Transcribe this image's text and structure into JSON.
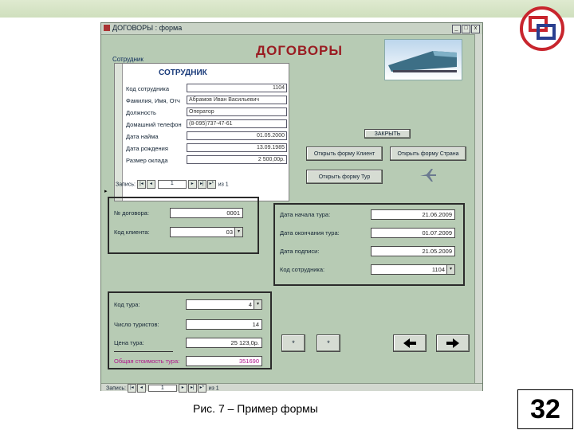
{
  "window": {
    "title": "ДОГОВОРЫ : форма",
    "min": "_",
    "max": "□",
    "close": "x"
  },
  "form": {
    "heading": "ДОГОВОРЫ",
    "subform_caption": "Сотрудник",
    "employee": {
      "title": "СОТРУДНИК",
      "fields": [
        {
          "label": "Код сотрудника",
          "value": "1104"
        },
        {
          "label": "Фамилия, Имя, Отч",
          "value": "Абрамов Иван Васильевич"
        },
        {
          "label": "Должность",
          "value": "Оператор"
        },
        {
          "label": "Домашний телефон",
          "value": "(8-095)737-47-61"
        },
        {
          "label": "Дата найма",
          "value": "01.05.2000"
        },
        {
          "label": "Дата рождения",
          "value": "13.09.1985"
        },
        {
          "label": "Размер оклада",
          "value": "2 500,00р."
        }
      ],
      "nav": {
        "label": "Запись:",
        "record": "1",
        "of": "из 1"
      }
    },
    "buttons": {
      "zakryt": "ЗАКРЫТЬ",
      "open_clients": "Открыть форму Клиент",
      "open_countries": "Открыть форму Страна",
      "open_tours": "Открыть форму Тур"
    },
    "group1": {
      "fields": [
        {
          "label": "№ договора:",
          "value": "0001"
        },
        {
          "label": "Код клиента:",
          "value": "03"
        }
      ]
    },
    "group2": {
      "fields": [
        {
          "label": "Дата начала тура:",
          "value": "21.06.2009"
        },
        {
          "label": "Дата окончания тура:",
          "value": "01.07.2009"
        },
        {
          "label": "Дата подписи:",
          "value": "21.05.2009"
        },
        {
          "label": "Код сотрудника:",
          "value": "1104"
        }
      ]
    },
    "group3": {
      "fields": [
        {
          "label": "Код тура:",
          "value": "4"
        },
        {
          "label": "Число туристов:",
          "value": "14"
        },
        {
          "label": "Цена тура:",
          "value": "25 123,0р."
        },
        {
          "label": "Общая стоимость тура:",
          "value": "351690"
        }
      ]
    },
    "bottom_nav": {
      "label": "Запись:",
      "record": "1",
      "of": "из 1"
    }
  },
  "caption": "Рис. 7 – Пример формы",
  "page_number": "32"
}
